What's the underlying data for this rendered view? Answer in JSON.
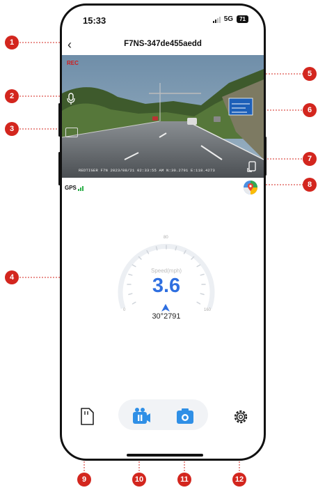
{
  "status": {
    "time": "15:33",
    "network": "5G",
    "battery": "71"
  },
  "header": {
    "back_icon": "chevron-left-icon",
    "device_name": "F7NS-347de455aedd"
  },
  "feed": {
    "rec_label": "REC",
    "overlay": "REDTIGER F7N 2023/08/21 02:33:55 AM N:30.2791 E:118.4273"
  },
  "gps": {
    "label": "GPS"
  },
  "speedometer": {
    "unit_label": "Speed(mph)",
    "value": "3.6",
    "coordinate": "30°2791",
    "ticks": {
      "min": "0",
      "mid": "80",
      "max": "160"
    }
  },
  "callouts": [
    "1",
    "2",
    "3",
    "4",
    "5",
    "6",
    "7",
    "8",
    "9",
    "10",
    "11",
    "12"
  ],
  "colors": {
    "accent": "#2f6fe0",
    "callout": "#d3261e",
    "gps_bars": "#2eb04a"
  }
}
